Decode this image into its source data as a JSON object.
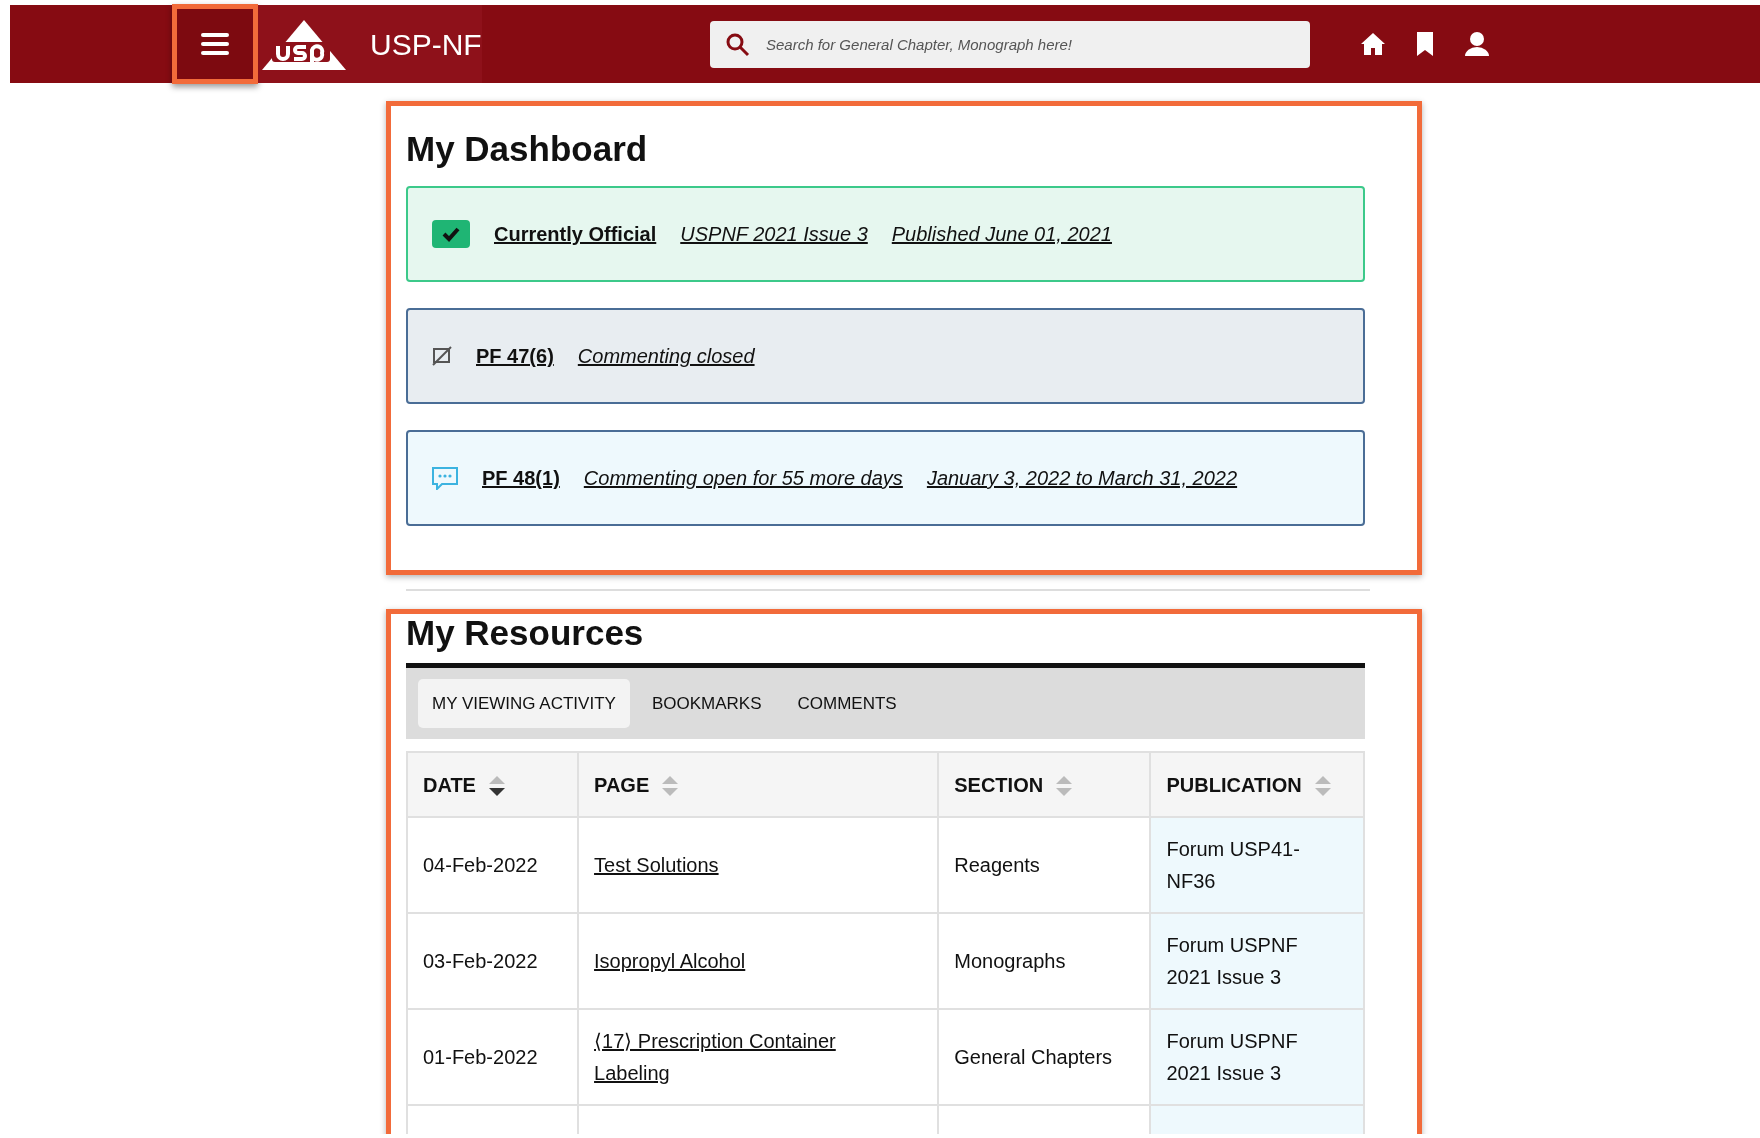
{
  "header": {
    "menu_button": {
      "highlighted": true
    },
    "brand": "USP-NF",
    "search": {
      "placeholder": "Search for General Chapter, Monograph here!"
    }
  },
  "dashboard": {
    "title": "My Dashboard",
    "highlighted": true,
    "cards": [
      {
        "kind": "official",
        "title": "Currently Official",
        "details": [
          "USPNF 2021 Issue 3",
          "Published June 01, 2021"
        ]
      },
      {
        "kind": "closed",
        "title": "PF 47(6)",
        "details": [
          "Commenting closed"
        ]
      },
      {
        "kind": "open",
        "title": "PF 48(1)",
        "details": [
          "Commenting open for 55 more days",
          "January 3, 2022 to March 31, 2022"
        ]
      }
    ]
  },
  "resources": {
    "title": "My Resources",
    "highlighted": true,
    "tabs": [
      {
        "label": "MY VIEWING ACTIVITY",
        "selected": true
      },
      {
        "label": "BOOKMARKS",
        "selected": false
      },
      {
        "label": "COMMENTS",
        "selected": false
      }
    ],
    "table": {
      "columns": [
        {
          "label": "DATE",
          "sorted": true,
          "highlighted": false
        },
        {
          "label": "PAGE",
          "sorted": false,
          "highlighted": false
        },
        {
          "label": "SECTION",
          "sorted": false,
          "highlighted": false
        },
        {
          "label": "PUBLICATION",
          "sorted": false,
          "highlighted": true
        }
      ],
      "rows": [
        [
          "04-Feb-2022",
          "Test Solutions",
          "Reagents",
          "Forum USP41-NF36"
        ],
        [
          "03-Feb-2022",
          "Isopropyl Alcohol",
          "Monographs",
          "Forum USPNF 2021 Issue 3"
        ],
        [
          "01-Feb-2022",
          "⟨17⟩ Prescription Container Labeling",
          "General Chapters",
          "Forum USPNF 2021 Issue 3"
        ]
      ]
    }
  }
}
